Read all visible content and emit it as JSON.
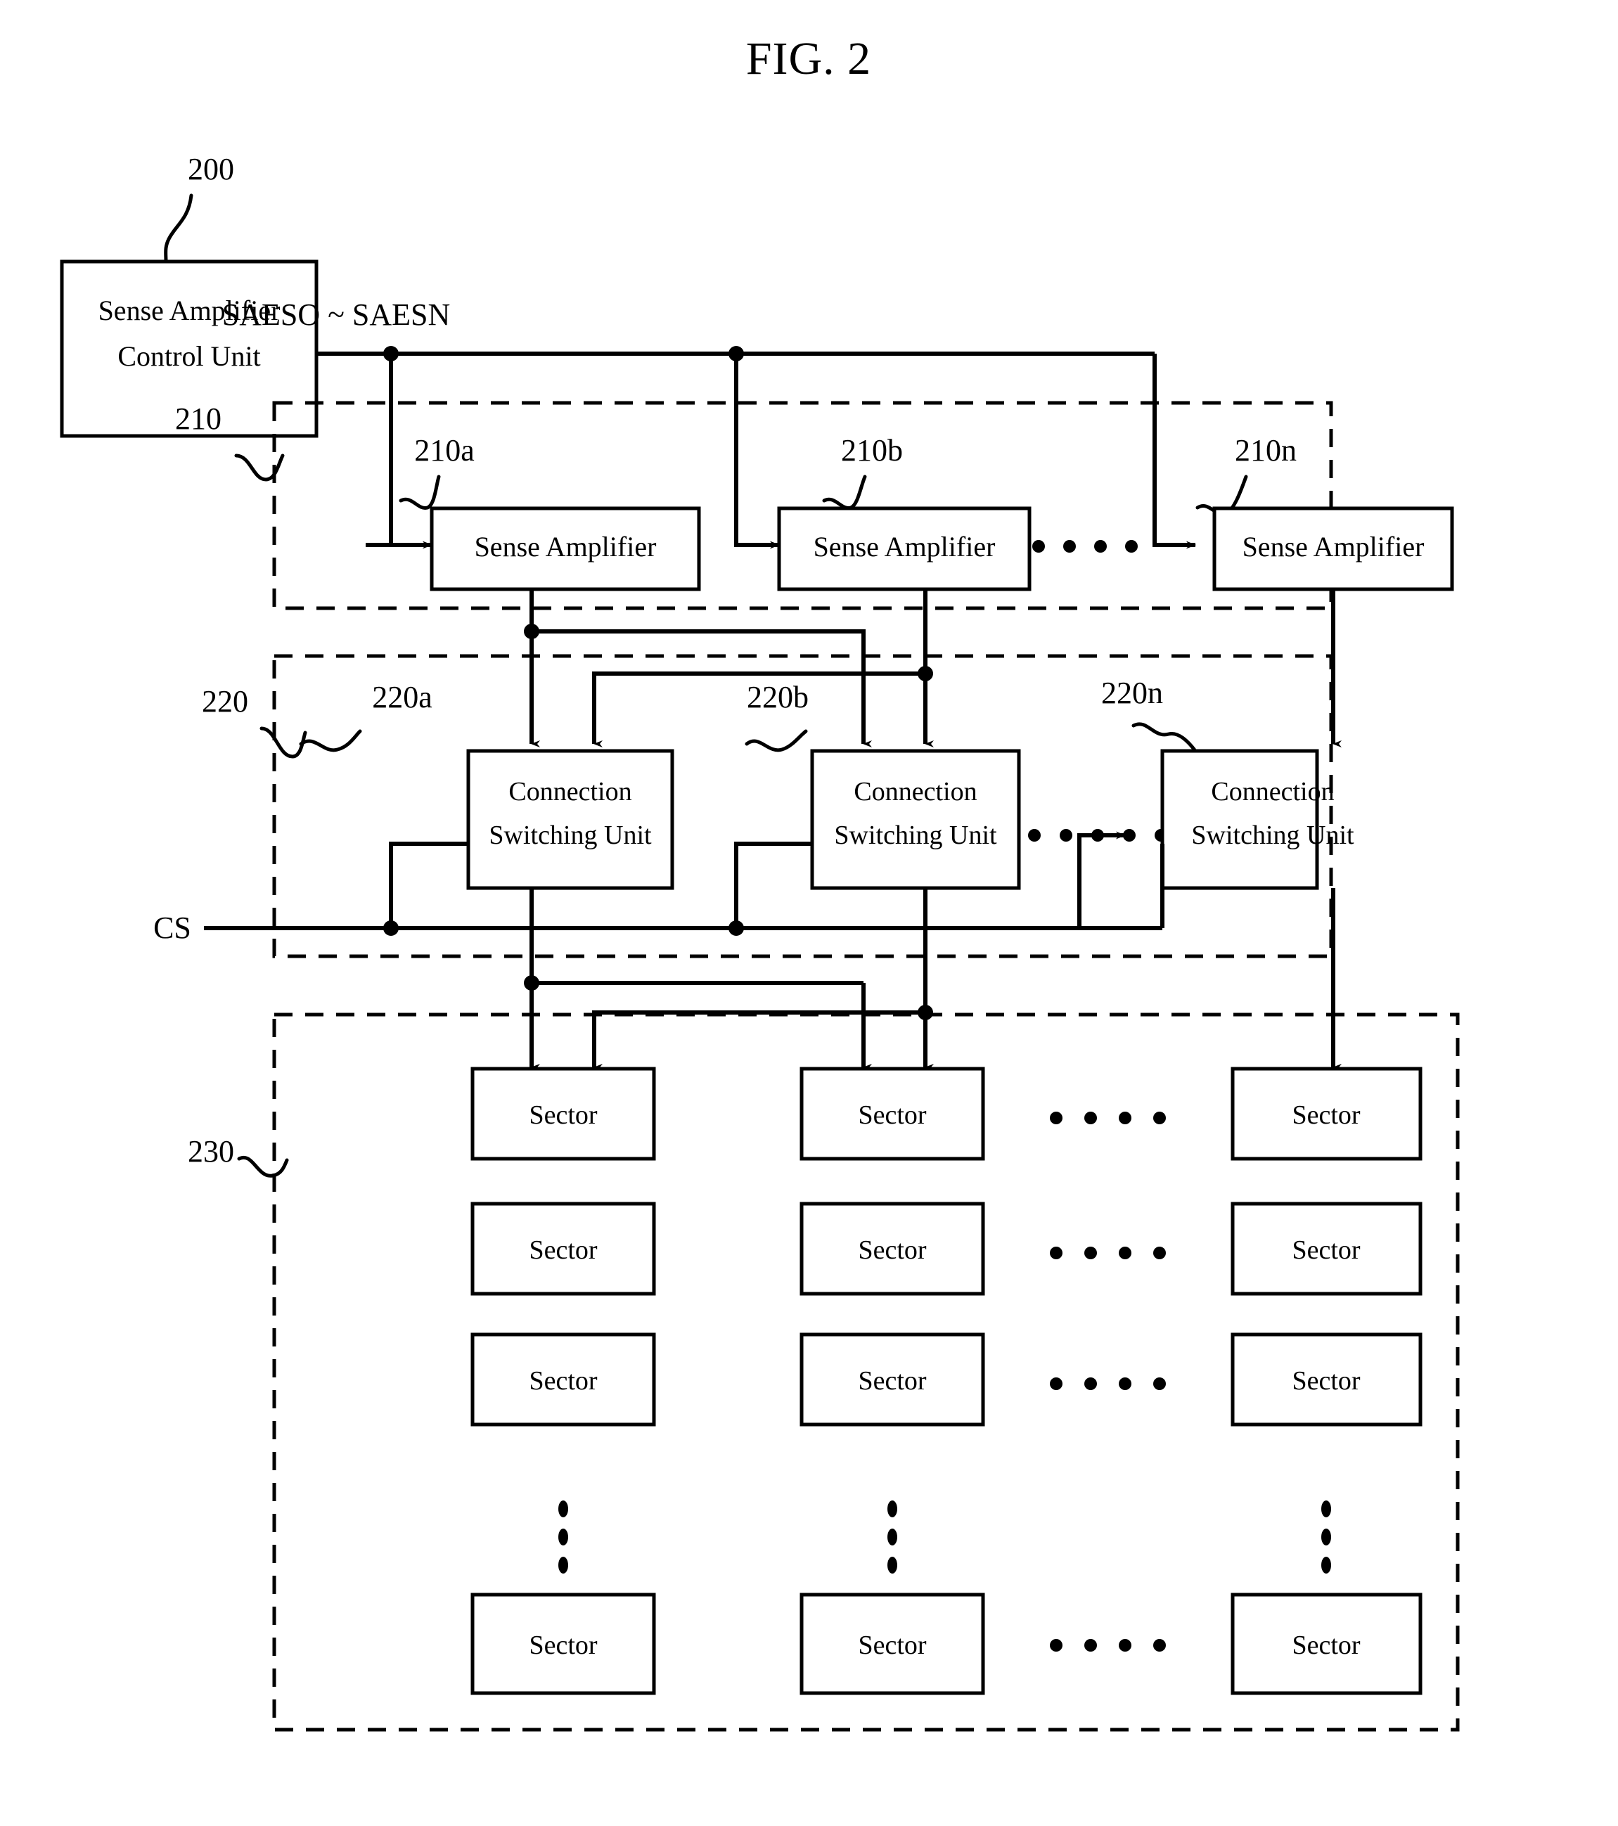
{
  "figure": {
    "title": "FIG. 2"
  },
  "signals": {
    "sae_bus": "SAESO ~ SAESN",
    "cs": "CS"
  },
  "refs": {
    "control_unit": "200",
    "sense_amp_group": "210",
    "sense_amp_a": "210a",
    "sense_amp_b": "210b",
    "sense_amp_n": "210n",
    "switching_group": "220",
    "switching_a": "220a",
    "switching_b": "220b",
    "switching_n": "220n",
    "sector_array": "230"
  },
  "blocks": {
    "control_unit": {
      "line1": "Sense Amplifier",
      "line2": "Control Unit"
    },
    "sense_amplifier": {
      "label": "Sense Amplifier"
    },
    "connection_switching_unit": {
      "line1": "Connection",
      "line2": "Switching Unit"
    },
    "sector": {
      "label": "Sector"
    }
  },
  "sense_amplifiers": [
    {
      "ref": "210a",
      "label": "Sense Amplifier"
    },
    {
      "ref": "210b",
      "label": "Sense Amplifier"
    },
    {
      "ref": "210n",
      "label": "Sense Amplifier"
    }
  ],
  "switching_units": [
    {
      "ref": "220a",
      "line1": "Connection",
      "line2": "Switching Unit"
    },
    {
      "ref": "220b",
      "line1": "Connection",
      "line2": "Switching Unit"
    },
    {
      "ref": "220n",
      "line1": "Connection",
      "line2": "Switching Unit"
    }
  ],
  "sector_grid": {
    "rows": [
      [
        "Sector",
        "Sector",
        "Sector"
      ],
      [
        "Sector",
        "Sector",
        "Sector"
      ],
      [
        "Sector",
        "Sector",
        "Sector"
      ],
      [
        "Sector",
        "Sector",
        "Sector"
      ]
    ],
    "row_ellipsis": "• • • •",
    "column_ellipsis": "⋮"
  },
  "ellipses": {
    "sense_amp_row": "• • • •",
    "switching_row": "• • • • •"
  },
  "colors": {
    "ink": "#000000",
    "paper": "#ffffff"
  }
}
